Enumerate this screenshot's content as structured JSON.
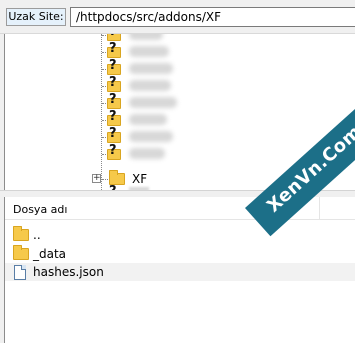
{
  "remote_site": {
    "label": "Uzak Site:",
    "path": "/httpdocs/src/addons/XF"
  },
  "tree": {
    "items": [
      {
        "icon": "unknown-folder-icon",
        "name_blurred": true
      },
      {
        "icon": "unknown-folder-icon",
        "name_blurred": true
      },
      {
        "icon": "unknown-folder-icon",
        "name_blurred": true
      },
      {
        "icon": "unknown-folder-icon",
        "name_blurred": true
      },
      {
        "icon": "unknown-folder-icon",
        "name_blurred": true
      },
      {
        "icon": "unknown-folder-icon",
        "name_blurred": true
      },
      {
        "icon": "unknown-folder-icon",
        "name_blurred": true
      },
      {
        "icon": "unknown-folder-icon",
        "name_blurred": true
      },
      {
        "icon": "unknown-folder-icon",
        "name_blurred": true
      }
    ],
    "xf_folder": {
      "label": "XF",
      "expander": "+"
    }
  },
  "file_list": {
    "header": "Dosya adı",
    "rows": [
      {
        "name": "..",
        "icon": "folder-icon"
      },
      {
        "name": "_data",
        "icon": "folder-icon"
      },
      {
        "name": "hashes.json",
        "icon": "file-icon"
      }
    ]
  },
  "watermark": {
    "text": "XenVn.Com"
  },
  "colors": {
    "folder": "#f6c94a",
    "watermark": "#1c6f88"
  }
}
